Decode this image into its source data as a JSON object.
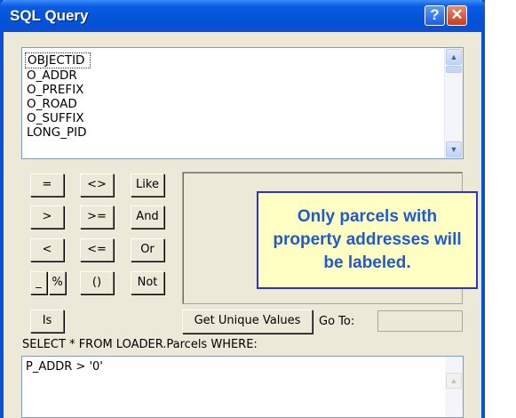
{
  "window": {
    "title": "SQL Query",
    "help_label": "?",
    "close_label": "✕"
  },
  "fields": [
    "OBJECTID",
    "O_ADDR",
    "O_PREFIX",
    "O_ROAD",
    "O_SUFFIX",
    "LONG_PID"
  ],
  "operators": [
    {
      "label": "=",
      "name": "equals-button"
    },
    {
      "label": "<>",
      "name": "not-equal-button"
    },
    {
      "label": "Like",
      "name": "like-button"
    },
    {
      "label": ">",
      "name": "greater-than-button"
    },
    {
      "label": ">=",
      "name": "greater-equal-button"
    },
    {
      "label": "And",
      "name": "and-button"
    },
    {
      "label": "<",
      "name": "less-than-button"
    },
    {
      "label": "<=",
      "name": "less-equal-button"
    },
    {
      "label": "Or",
      "name": "or-button"
    },
    {
      "label": "_",
      "name": "underscore-button"
    },
    {
      "label": "%",
      "name": "percent-button"
    },
    {
      "label": "()",
      "name": "parentheses-button"
    },
    {
      "label": "Not",
      "name": "not-button"
    },
    {
      "label": "Is",
      "name": "is-button"
    }
  ],
  "get_unique_values_label": "Get Unique Values",
  "go_to_label": "Go To:",
  "sql_prefix": "SELECT * FROM LOADER.Parcels WHERE:",
  "sql_expression": "P_ADDR > '0'",
  "callout_text": "Only parcels with property addresses will be labeled."
}
